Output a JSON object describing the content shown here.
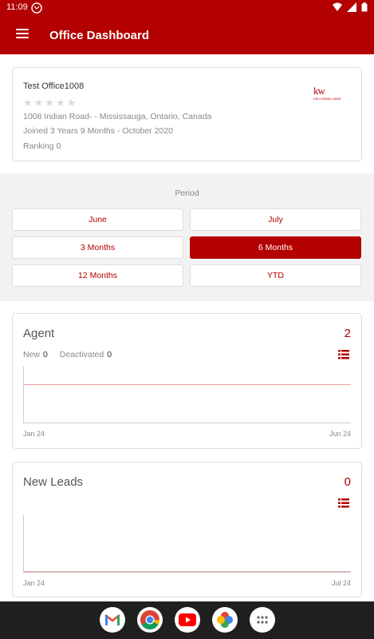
{
  "status_bar": {
    "time": "11:09",
    "icons": [
      "gmail-notification-icon",
      "wifi-icon",
      "signal-icon",
      "battery-icon"
    ]
  },
  "app_bar": {
    "title": "Office Dashboard",
    "menu_icon": "hamburger-menu-icon"
  },
  "office": {
    "name": "Test Office1008",
    "rating_stars": 0,
    "stars_display": "★★★★★",
    "address": "1008 Indian Road- - Mississauga,  Ontario,  Canada",
    "joined": "Joined 3 Years 9 Months - October 2020",
    "ranking": "Ranking 0",
    "logo_text": "kw",
    "logo_sub": "KELLERWILLIAMS"
  },
  "period": {
    "label": "Period",
    "options": [
      "June",
      "July",
      "3 Months",
      "6 Months",
      "12 Months",
      "YTD"
    ],
    "selected": "6 Months"
  },
  "agent_card": {
    "title": "Agent",
    "count": "2",
    "new_label": "New",
    "new_value": "0",
    "deactivated_label": "Deactivated",
    "deactivated_value": "0",
    "x_start": "Jan 24",
    "x_end": "Jun 24"
  },
  "leads_card": {
    "title": "New Leads",
    "count": "0",
    "x_start": "Jan 24",
    "x_end": "Jul 24"
  },
  "dock": {
    "apps": [
      "gmail-icon",
      "chrome-icon",
      "youtube-icon",
      "photos-icon",
      "app-drawer-icon"
    ]
  },
  "colors": {
    "brand": "#b30000",
    "background_section": "#f2f2f2",
    "nav_bar": "#1f1f1f"
  }
}
